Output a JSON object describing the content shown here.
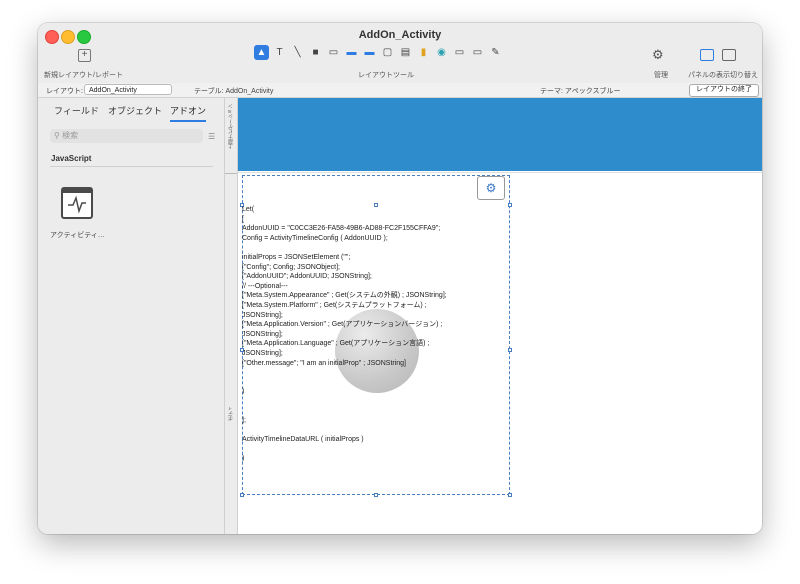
{
  "window": {
    "title": "AddOn_Activity"
  },
  "toolbar": {
    "new_layout_label": "新規レイアウト/レポート",
    "layout_tools_label": "レイアウトツール",
    "manage_label": "管理",
    "panel_toggle_label": "パネルの表示切り替え",
    "icons": [
      "pointer-icon",
      "text-icon",
      "line-icon",
      "rect-icon",
      "field-icon",
      "button-icon",
      "button-bar-icon",
      "popover-icon",
      "portal-icon",
      "chart-icon",
      "webviewer-icon",
      "tab-icon",
      "slide-icon",
      "eyedropper-icon"
    ]
  },
  "subbar": {
    "layout_prefix": "レイアウト:",
    "layout_value": "AddOn_Activity",
    "table_label": "テーブル: AddOn_Activity",
    "theme_label": "テーマ: アペックスブルー",
    "exit_label": "レイアウトの終了"
  },
  "sidebar": {
    "tabs": [
      {
        "label": "フィールド"
      },
      {
        "label": "オブジェクト"
      },
      {
        "label": "アドオン"
      }
    ],
    "search_placeholder": "検索",
    "section_label": "JavaScript",
    "addon_item_label": "アクティビティ…"
  },
  "ruler": {
    "top_label": "上部ナビゲーション",
    "body_label": "ボディ"
  },
  "code_lines": [
    "Let(",
    "[",
    "AddonUUID = \"C0CC3E26-FA58-49B6-AD88-FC2F155CFFA9\";",
    "Config = ActivityTimelineConfig ( AddonUUID );",
    "",
    "initialProps = JSONSetElement (\"\";",
    "     [\"Config\"; Config; JSONObject];",
    "     [\"AddonUUID\"; AddonUUID; JSONString];",
    "        // ---Optional---",
    "     [\"Meta.System.Appearance\" ; Get(システムの外観) ; JSONString];",
    "     [\"Meta.System.Platform\" ; Get(システムプラットフォーム) ;",
    "JSONString];",
    "     [\"Meta.Application.Version\" ; Get(アプリケーションバージョン) ;",
    "JSONString];",
    "     [\"Meta.Application.Language\" ; Get(アプリケーション言語) ;",
    "JSONString];",
    "     [\"Other.message\"; \"I am an initialProp\" ; JSONString]",
    "",
    "",
    "     )",
    "",
    "",
    "];",
    "",
    "ActivityTimelineDataURL ( initialProps )",
    "",
    ")"
  ]
}
